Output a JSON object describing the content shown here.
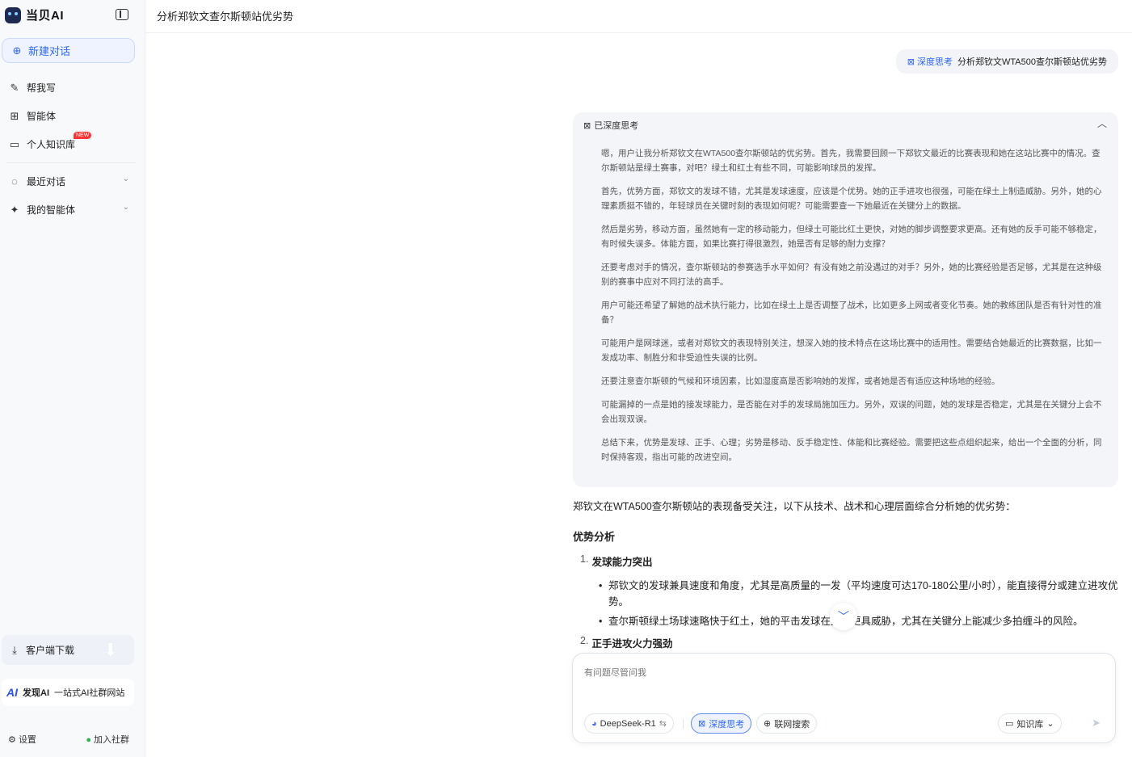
{
  "brand": {
    "name": "当贝AI"
  },
  "sidebar": {
    "new_chat": "新建对话",
    "items": [
      {
        "label": "帮我写",
        "icon": "pen-icon"
      },
      {
        "label": "智能体",
        "icon": "grid-icon"
      },
      {
        "label": "个人知识库",
        "icon": "folder-icon",
        "badge": "NEW"
      },
      {
        "label": "最近对话",
        "icon": "chat-icon"
      },
      {
        "label": "我的智能体",
        "icon": "sparkle-icon"
      }
    ],
    "download": "客户端下载",
    "promo": {
      "logo": "AI",
      "name": "发现AI",
      "tagline": "一站式AI社群网站"
    },
    "settings": "设置",
    "join": "加入社群"
  },
  "header": {
    "title": "分析郑钦文查尔斯顿站优劣势"
  },
  "user_message": {
    "tag": "深度思考",
    "text": "分析郑钦文WTA500查尔斯顿站优劣势"
  },
  "thinking": {
    "header": "已深度思考",
    "paragraphs": [
      "嗯，用户让我分析郑钦文在WTA500查尔斯顿站的优劣势。首先，我需要回顾一下郑钦文最近的比赛表现和她在这站比赛中的情况。查尔斯顿站是绿土赛事，对吧？绿土和红土有些不同，可能影响球员的发挥。",
      "首先，优势方面，郑钦文的发球不错，尤其是发球速度，应该是个优势。她的正手进攻也很强，可能在绿土上制造威胁。另外，她的心理素质挺不错的，年轻球员在关键时刻的表现如何呢？可能需要查一下她最近在关键分上的数据。",
      "然后是劣势，移动方面，虽然她有一定的移动能力，但绿土可能比红土更快，对她的脚步调整要求更高。还有她的反手可能不够稳定，有时候失误多。体能方面，如果比赛打得很激烈，她是否有足够的耐力支撑？",
      "还要考虑对手的情况，查尔斯顿站的参赛选手水平如何？有没有她之前没遇过的对手？另外，她的比赛经验是否足够，尤其是在这种级别的赛事中应对不同打法的高手。",
      "用户可能还希望了解她的战术执行能力，比如在绿土上是否调整了战术，比如更多上网或者变化节奏。她的教练团队是否有针对性的准备？",
      "可能用户是网球迷，或者对郑钦文的表现特别关注，想深入她的技术特点在这场比赛中的适用性。需要结合她最近的比赛数据，比如一发成功率、制胜分和非受迫性失误的比例。",
      "还要注意查尔斯顿的气候和环境因素，比如湿度高是否影响她的发挥，或者她是否有适应这种场地的经验。",
      "可能漏掉的一点是她的接发球能力，是否能在对手的发球局施加压力。另外，双误的问题，她的发球是否稳定，尤其是在关键分上会不会出现双误。",
      "总结下来，优势是发球、正手、心理；劣势是移动、反手稳定性、体能和比赛经验。需要把这些点组织起来，给出一个全面的分析，同时保持客观，指出可能的改进空间。"
    ]
  },
  "answer": {
    "intro": "郑钦文在WTA500查尔斯顿站的表现备受关注，以下从技术、战术和心理层面综合分析她的优劣势：",
    "section_title": "优势分析",
    "points": [
      {
        "num": "1.",
        "title": "发球能力突出",
        "bullets": [
          "郑钦文的发球兼具速度和角度，尤其是高质量的一发（平均速度可达170-180公里/小时），能直接得分或建立进攻优势。",
          "查尔斯顿绿土场球速略快于红土，她的平击发球在此时更具威胁，尤其在关键分上能减少多拍缠斗的风险。"
        ]
      },
      {
        "num": "2.",
        "title": "正手进攻火力强劲"
      }
    ]
  },
  "composer": {
    "placeholder": "有问题尽管问我",
    "model": "DeepSeek-R1",
    "deep_think": "深度思考",
    "web_search": "联网搜索",
    "knowledge": "知识库"
  }
}
